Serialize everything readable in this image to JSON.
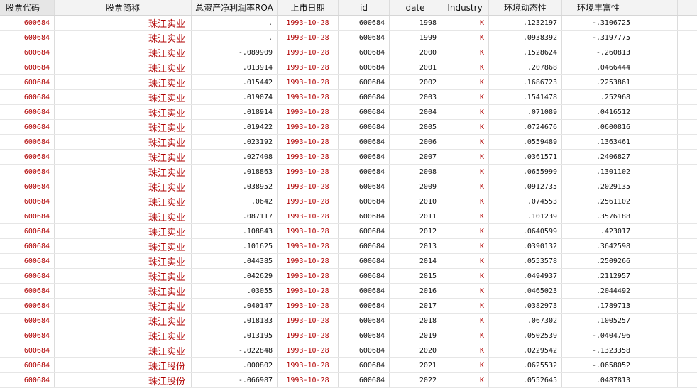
{
  "columns": [
    "股票代码",
    "股票简称",
    "总资产净利润率ROA",
    "上市日期",
    "id",
    "date",
    "Industry",
    "环境动态性",
    "环境丰富性"
  ],
  "rows": [
    [
      "600684",
      "珠江实业",
      ".",
      "1993-10-28",
      "600684",
      "1998",
      "K",
      ".1232197",
      "-.3106725"
    ],
    [
      "600684",
      "珠江实业",
      ".",
      "1993-10-28",
      "600684",
      "1999",
      "K",
      ".0938392",
      "-.3197775"
    ],
    [
      "600684",
      "珠江实业",
      "-.089909",
      "1993-10-28",
      "600684",
      "2000",
      "K",
      ".1528624",
      "-.260813"
    ],
    [
      "600684",
      "珠江实业",
      ".013914",
      "1993-10-28",
      "600684",
      "2001",
      "K",
      ".207868",
      ".0466444"
    ],
    [
      "600684",
      "珠江实业",
      ".015442",
      "1993-10-28",
      "600684",
      "2002",
      "K",
      ".1686723",
      ".2253861"
    ],
    [
      "600684",
      "珠江实业",
      ".019074",
      "1993-10-28",
      "600684",
      "2003",
      "K",
      ".1541478",
      ".252968"
    ],
    [
      "600684",
      "珠江实业",
      ".018914",
      "1993-10-28",
      "600684",
      "2004",
      "K",
      ".071089",
      ".0416512"
    ],
    [
      "600684",
      "珠江实业",
      ".019422",
      "1993-10-28",
      "600684",
      "2005",
      "K",
      ".0724676",
      ".0600816"
    ],
    [
      "600684",
      "珠江实业",
      ".023192",
      "1993-10-28",
      "600684",
      "2006",
      "K",
      ".0559489",
      ".1363461"
    ],
    [
      "600684",
      "珠江实业",
      ".027408",
      "1993-10-28",
      "600684",
      "2007",
      "K",
      ".0361571",
      ".2406827"
    ],
    [
      "600684",
      "珠江实业",
      ".018863",
      "1993-10-28",
      "600684",
      "2008",
      "K",
      ".0655999",
      ".1301102"
    ],
    [
      "600684",
      "珠江实业",
      ".038952",
      "1993-10-28",
      "600684",
      "2009",
      "K",
      ".0912735",
      ".2029135"
    ],
    [
      "600684",
      "珠江实业",
      ".0642",
      "1993-10-28",
      "600684",
      "2010",
      "K",
      ".074553",
      ".2561102"
    ],
    [
      "600684",
      "珠江实业",
      ".087117",
      "1993-10-28",
      "600684",
      "2011",
      "K",
      ".101239",
      ".3576188"
    ],
    [
      "600684",
      "珠江实业",
      ".108843",
      "1993-10-28",
      "600684",
      "2012",
      "K",
      ".0640599",
      ".423017"
    ],
    [
      "600684",
      "珠江实业",
      ".101625",
      "1993-10-28",
      "600684",
      "2013",
      "K",
      ".0390132",
      ".3642598"
    ],
    [
      "600684",
      "珠江实业",
      ".044385",
      "1993-10-28",
      "600684",
      "2014",
      "K",
      ".0553578",
      ".2509266"
    ],
    [
      "600684",
      "珠江实业",
      ".042629",
      "1993-10-28",
      "600684",
      "2015",
      "K",
      ".0494937",
      ".2112957"
    ],
    [
      "600684",
      "珠江实业",
      ".03055",
      "1993-10-28",
      "600684",
      "2016",
      "K",
      ".0465023",
      ".2044492"
    ],
    [
      "600684",
      "珠江实业",
      ".040147",
      "1993-10-28",
      "600684",
      "2017",
      "K",
      ".0382973",
      ".1789713"
    ],
    [
      "600684",
      "珠江实业",
      ".018183",
      "1993-10-28",
      "600684",
      "2018",
      "K",
      ".067302",
      ".1005257"
    ],
    [
      "600684",
      "珠江实业",
      ".013195",
      "1993-10-28",
      "600684",
      "2019",
      "K",
      ".0502539",
      "-.0404796"
    ],
    [
      "600684",
      "珠江实业",
      "-.022848",
      "1993-10-28",
      "600684",
      "2020",
      "K",
      ".0229542",
      "-.1323358"
    ],
    [
      "600684",
      "珠江股份",
      ".000802",
      "1993-10-28",
      "600684",
      "2021",
      "K",
      ".0625532",
      "-.0658052"
    ],
    [
      "600684",
      "珠江股份",
      "-.066987",
      "1993-10-28",
      "600684",
      "2022",
      "K",
      ".0552645",
      ".0487813"
    ]
  ]
}
